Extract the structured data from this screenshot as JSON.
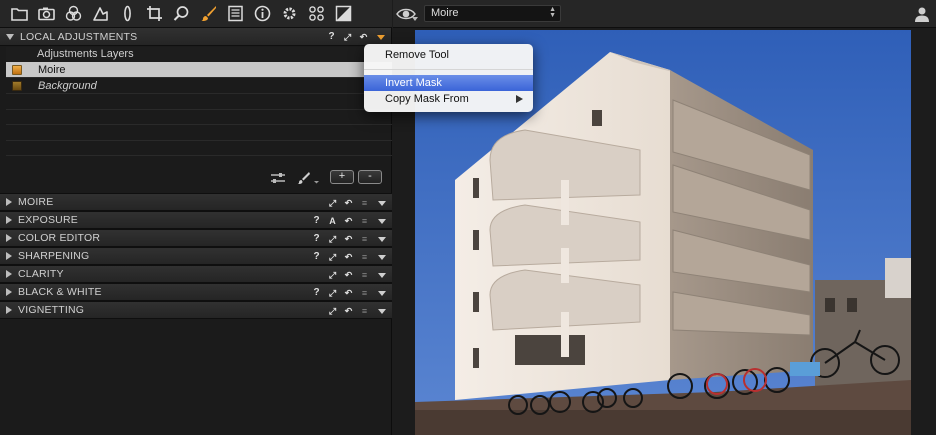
{
  "toolbar": {
    "icons": [
      "folder-icon",
      "camera-icon",
      "color-circles-icon",
      "shape-icon",
      "lens-icon",
      "crop-icon",
      "loupe-icon",
      "brush-icon",
      "list-icon",
      "info-icon",
      "gear-icon",
      "dots-icon",
      "exposure-icon"
    ],
    "active_icon": "brush-icon",
    "active_color": "#f0a030"
  },
  "local_adjustments": {
    "title": "LOCAL ADJUSTMENTS",
    "help": "?",
    "layers_header": "Adjustments Layers",
    "layers": [
      {
        "name": "Moire",
        "selected": true,
        "checked": true
      },
      {
        "name": "Background",
        "selected": false,
        "checked": true
      }
    ],
    "add_label": "+",
    "remove_label": "-"
  },
  "sections": [
    {
      "title": "MOIRE",
      "help": "",
      "auto": ""
    },
    {
      "title": "EXPOSURE",
      "help": "?",
      "auto": "A"
    },
    {
      "title": "COLOR EDITOR",
      "help": "?",
      "auto": ""
    },
    {
      "title": "SHARPENING",
      "help": "?",
      "auto": ""
    },
    {
      "title": "CLARITY",
      "help": "",
      "auto": ""
    },
    {
      "title": "BLACK & WHITE",
      "help": "?",
      "auto": ""
    },
    {
      "title": "VIGNETTING",
      "help": "",
      "auto": ""
    }
  ],
  "viewer": {
    "variant_name": "Moire",
    "select_arrows": "▲▼"
  },
  "context_menu": {
    "items": [
      "Remove Tool",
      "Invert Mask",
      "Copy Mask From"
    ],
    "highlighted": "Invert Mask"
  },
  "colors": {
    "accent": "#f0a030",
    "menu_highlight": "#3a64d8",
    "sky": "#3d6fc7"
  }
}
